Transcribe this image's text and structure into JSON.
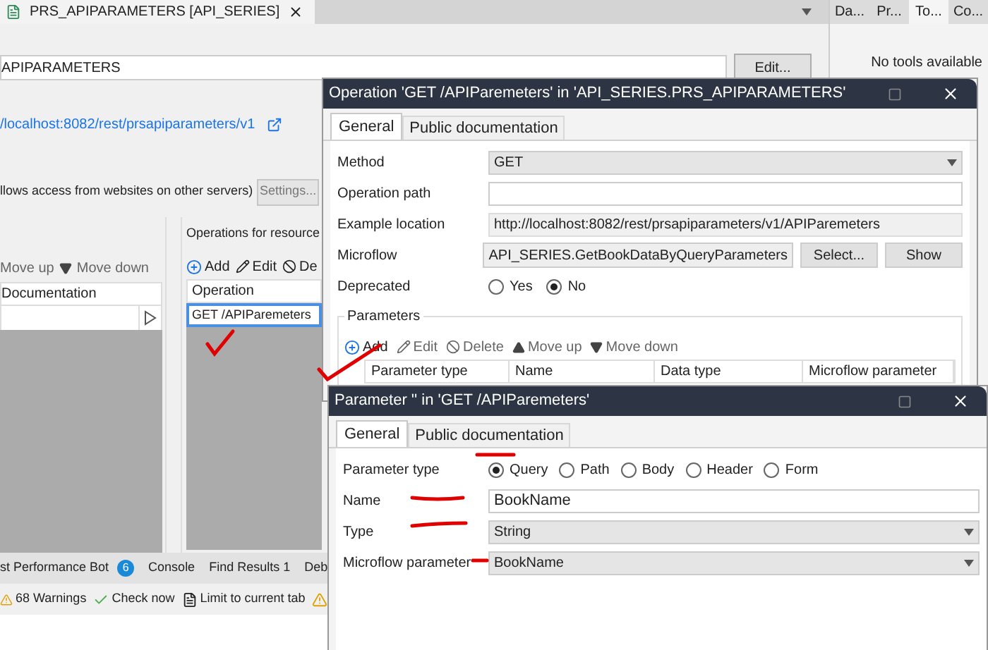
{
  "editor_tab": {
    "title": "PRS_APIPARAMETERS [API_SERIES]"
  },
  "side_tabs": [
    {
      "label": "Da...",
      "selected": false
    },
    {
      "label": "Pr...",
      "selected": false
    },
    {
      "label": "To...",
      "selected": true
    },
    {
      "label": "Co...",
      "selected": false
    }
  ],
  "side_panel": {
    "message": "No tools available"
  },
  "document": {
    "name_value": "APIPARAMETERS",
    "edit_button": "Edit...",
    "location_link": "/localhost:8082/rest/prsapiparameters/v1",
    "cors_text": "llows access from websites on other servers)",
    "settings_button": "Settings..."
  },
  "resources": {
    "toolbar": [
      "Move up",
      "Move down"
    ],
    "column": "Documentation"
  },
  "operations": {
    "title": "Operations for resource",
    "toolbar": [
      "Add",
      "Edit",
      "De"
    ],
    "column": "Operation",
    "rows": [
      {
        "text": "GET /APIParemeters",
        "selected": true
      }
    ]
  },
  "bottom_tabs": [
    {
      "label": "st Performance Bot",
      "badge": "6"
    },
    {
      "label": "Console"
    },
    {
      "label": "Find Results 1"
    },
    {
      "label": "Deb"
    }
  ],
  "bottom_toolbar": {
    "warnings": "68 Warnings",
    "check": "Check now",
    "limit": "Limit to current tab"
  },
  "operation_dialog": {
    "title": "Operation 'GET /APIParemeters' in 'API_SERIES.PRS_APIPARAMETERS'",
    "tabs": [
      {
        "label": "General",
        "selected": true
      },
      {
        "label": "Public documentation",
        "selected": false
      }
    ],
    "method_label": "Method",
    "method": "GET",
    "path_label": "Operation path",
    "example_label": "Example location",
    "example": "http://localhost:8082/rest/prsapiparameters/v1/APIParemeters",
    "microflow_label": "Microflow",
    "microflow": "API_SERIES.GetBookDataByQueryParameters",
    "select_button": "Select...",
    "show_button": "Show",
    "deprecated_label": "Deprecated",
    "deprecated_options": [
      {
        "label": "Yes",
        "selected": false
      },
      {
        "label": "No",
        "selected": true
      }
    ],
    "parameters_title": "Parameters",
    "parameters_toolbar": [
      "Add",
      "Edit",
      "Delete",
      "Move up",
      "Move down"
    ],
    "parameters_columns": [
      "Parameter type",
      "Name",
      "Data type",
      "Microflow parameter"
    ]
  },
  "parameter_dialog": {
    "title": "Parameter '' in 'GET /APIParemeters'",
    "tabs": [
      {
        "label": "General",
        "selected": true
      },
      {
        "label": "Public documentation",
        "selected": false
      }
    ],
    "type_label": "Parameter type",
    "type_options": [
      {
        "label": "Query",
        "selected": true
      },
      {
        "label": "Path",
        "selected": false
      },
      {
        "label": "Body",
        "selected": false
      },
      {
        "label": "Header",
        "selected": false
      },
      {
        "label": "Form",
        "selected": false
      }
    ],
    "name_label": "Name",
    "name": "BookName",
    "datatype_label": "Type",
    "datatype": "String",
    "microflow_param_label": "Microflow parameter",
    "microflow_param": "BookName"
  }
}
